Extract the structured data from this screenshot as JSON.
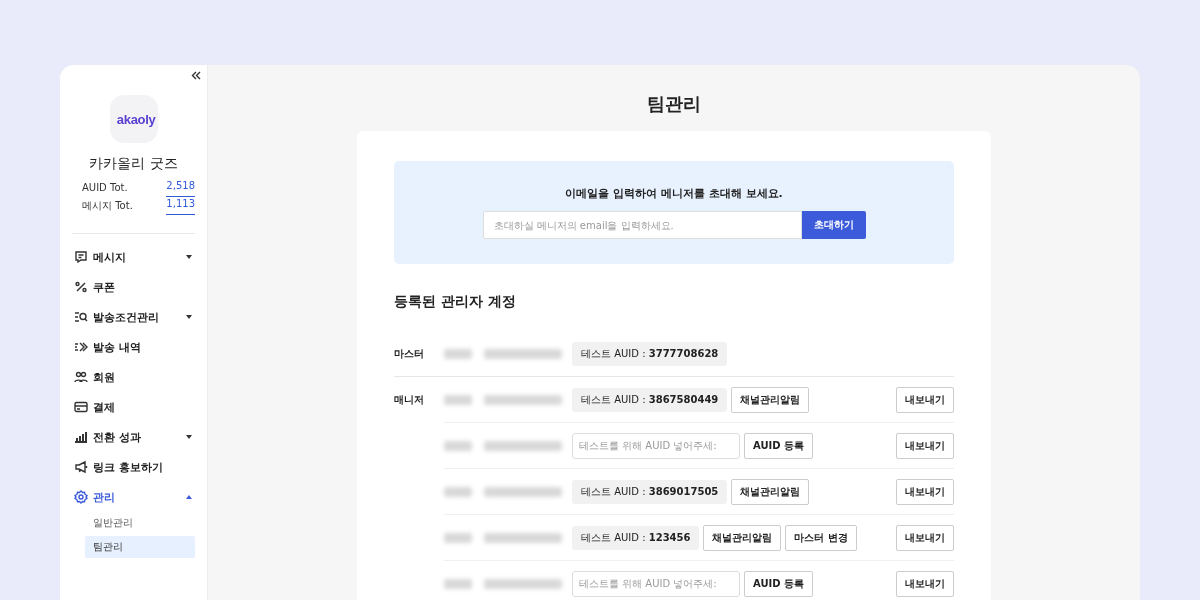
{
  "sidebar": {
    "logo": "akaoly",
    "shop_name": "카카올리 굿즈",
    "stats": [
      {
        "label": "AUID Tot.",
        "value": "2,518"
      },
      {
        "label": "메시지 Tot.",
        "value": "1,113"
      }
    ],
    "menu": [
      {
        "label": "메시지",
        "selected": false,
        "expanded": false
      },
      {
        "label": "쿠폰",
        "selected": false
      },
      {
        "label": "발송조건관리",
        "selected": false,
        "expanded": false
      },
      {
        "label": "발송 내역",
        "selected": false
      },
      {
        "label": "회원",
        "selected": false
      },
      {
        "label": "결제",
        "selected": false
      },
      {
        "label": "전환 성과",
        "selected": false,
        "expanded": false
      },
      {
        "label": "링크 홍보하기",
        "selected": false
      },
      {
        "label": "관리",
        "selected": true,
        "expanded": true,
        "children": [
          {
            "label": "일반관리",
            "selected": false
          },
          {
            "label": "팀관리",
            "selected": true
          }
        ]
      }
    ]
  },
  "page_title": "팀관리",
  "invite": {
    "prompt": "이메일을 입력하여 메니저를 초대해 보세요.",
    "placeholder": "초대하실 메니저의 email을 입력하세요.",
    "button": "초대하기"
  },
  "accounts_title": "등록된 관리자 계정",
  "groups": [
    {
      "label": "마스터",
      "rows": [
        {
          "kind": "auid",
          "auid": "테스트 AUID : **3777708628**"
        }
      ]
    },
    {
      "label": "매니저",
      "rows": [
        {
          "kind": "auid",
          "auid": "테스트 AUID : **3867580449**",
          "buttons": [
            "채널관리알림"
          ],
          "export": "내보내기"
        },
        {
          "kind": "input",
          "placeholder": "테스트를 위해 AUID 넣어주세:",
          "register": "AUID 등록",
          "export": "내보내기"
        },
        {
          "kind": "auid",
          "auid": "테스트 AUID : **3869017505**",
          "buttons": [
            "채널관리알림"
          ],
          "export": "내보내기"
        },
        {
          "kind": "auid",
          "auid": "테스트 AUID : **123456**",
          "buttons": [
            "채널관리알림",
            "마스터 변경"
          ],
          "export": "내보내기"
        },
        {
          "kind": "input",
          "placeholder": "테스트를 위해 AUID 넣어주세:",
          "register": "AUID 등록",
          "export": "내보내기"
        }
      ]
    }
  ]
}
